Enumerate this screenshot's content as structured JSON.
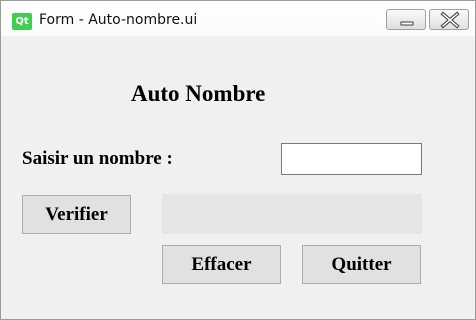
{
  "window": {
    "title": "Form - Auto-nombre.ui",
    "app_icon_text": "Qt",
    "app_icon_color": "#41cd52"
  },
  "form": {
    "heading": "Auto Nombre",
    "input_label": "Saisir un nombre :",
    "input_value": "",
    "result_text": "",
    "verify_label": "Verifier",
    "clear_label": "Effacer",
    "quit_label": "Quitter"
  }
}
